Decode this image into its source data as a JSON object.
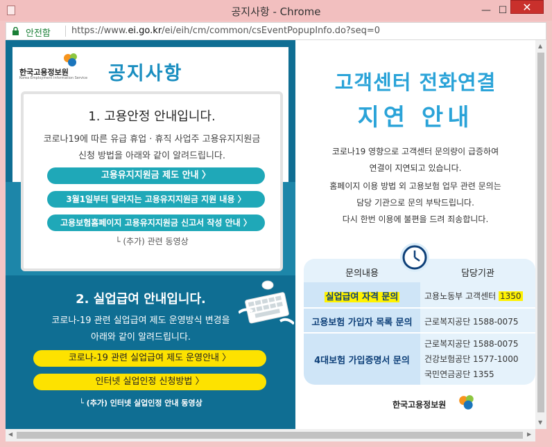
{
  "window": {
    "title": "공지사항 - Chrome",
    "minimize": "—",
    "maximize": "☐",
    "close": "✕"
  },
  "address": {
    "secure_label": "안전함",
    "url_prefix": "https://www.",
    "url_domain": "ei.go.kr",
    "url_path": "/ei/eih/cm/common/csEventPopupInfo.do?seq=0"
  },
  "left": {
    "logo_name": "한국고용정보원",
    "logo_sub": "Korea Employment Information Service",
    "notice_title": "공지사항",
    "section1": {
      "title": "1. 고용안정 안내입니다.",
      "line1": "코로나19에 따른 유급 휴업 · 휴직 사업주 고용유지지원금",
      "line2": "신청 방법을 아래와 같이 알려드립니다.",
      "buttons": [
        "고용유지지원금 제도 안내 〉",
        "3월1일부터 달라지는 고용유지지원금 지원 내용 〉",
        "고용보험홈페이지 고용유지지원금 신고서 작성 안내 〉"
      ],
      "note": "└ (추가) 관련 동영상"
    },
    "section2": {
      "title": "2. 실업급여 안내입니다.",
      "line1": "코로나-19 관련 실업급여 제도 운영방식 변경을",
      "line2": "아래와 같이 알려드립니다.",
      "buttons": [
        "코로나-19 관련 실업급여 제도 운영안내 〉",
        "인터넷 실업인정 신청방법 〉"
      ],
      "note": "└ (추가) 인터넷 실업인정 안내 동영상"
    }
  },
  "right": {
    "title1": "고객센터 전화연결",
    "title2": "지연 안내",
    "paragraph": [
      "코로나19 영향으로 고객센터 문의량이 급증하여",
      "연결이 지연되고 있습니다.",
      "홈페이지 이용 방법 외 고용보험 업무 관련 문의는",
      "담당 기관으로 문의 부탁드립니다.",
      "다시 한번 이용에 불편을 드려 죄송합니다."
    ],
    "table": {
      "headers": [
        "문의내용",
        "담당기관"
      ],
      "rows": [
        {
          "topic": "실업급여 자격 문의",
          "agency_text": "고용노동부 고객센터 ",
          "agency_num": "1350"
        },
        {
          "topic": "고용보험 가입자 목록 문의",
          "agency_text": "근로복지공단 1588-0075"
        },
        {
          "topic": "4대보험 가입증명서 문의",
          "agency_lines": [
            "근로복지공단 1588-0075",
            "건강보험공단 1577-1000",
            "국민연금공단 1355"
          ]
        }
      ]
    },
    "footer_logo": "한국고용정보원"
  },
  "colors": {
    "accent": "#2aa3d8",
    "teal_button": "#1fa8b8",
    "yellow_button": "#fde200",
    "navy_panel": "#0f6e93",
    "highlight": "#fff200"
  }
}
